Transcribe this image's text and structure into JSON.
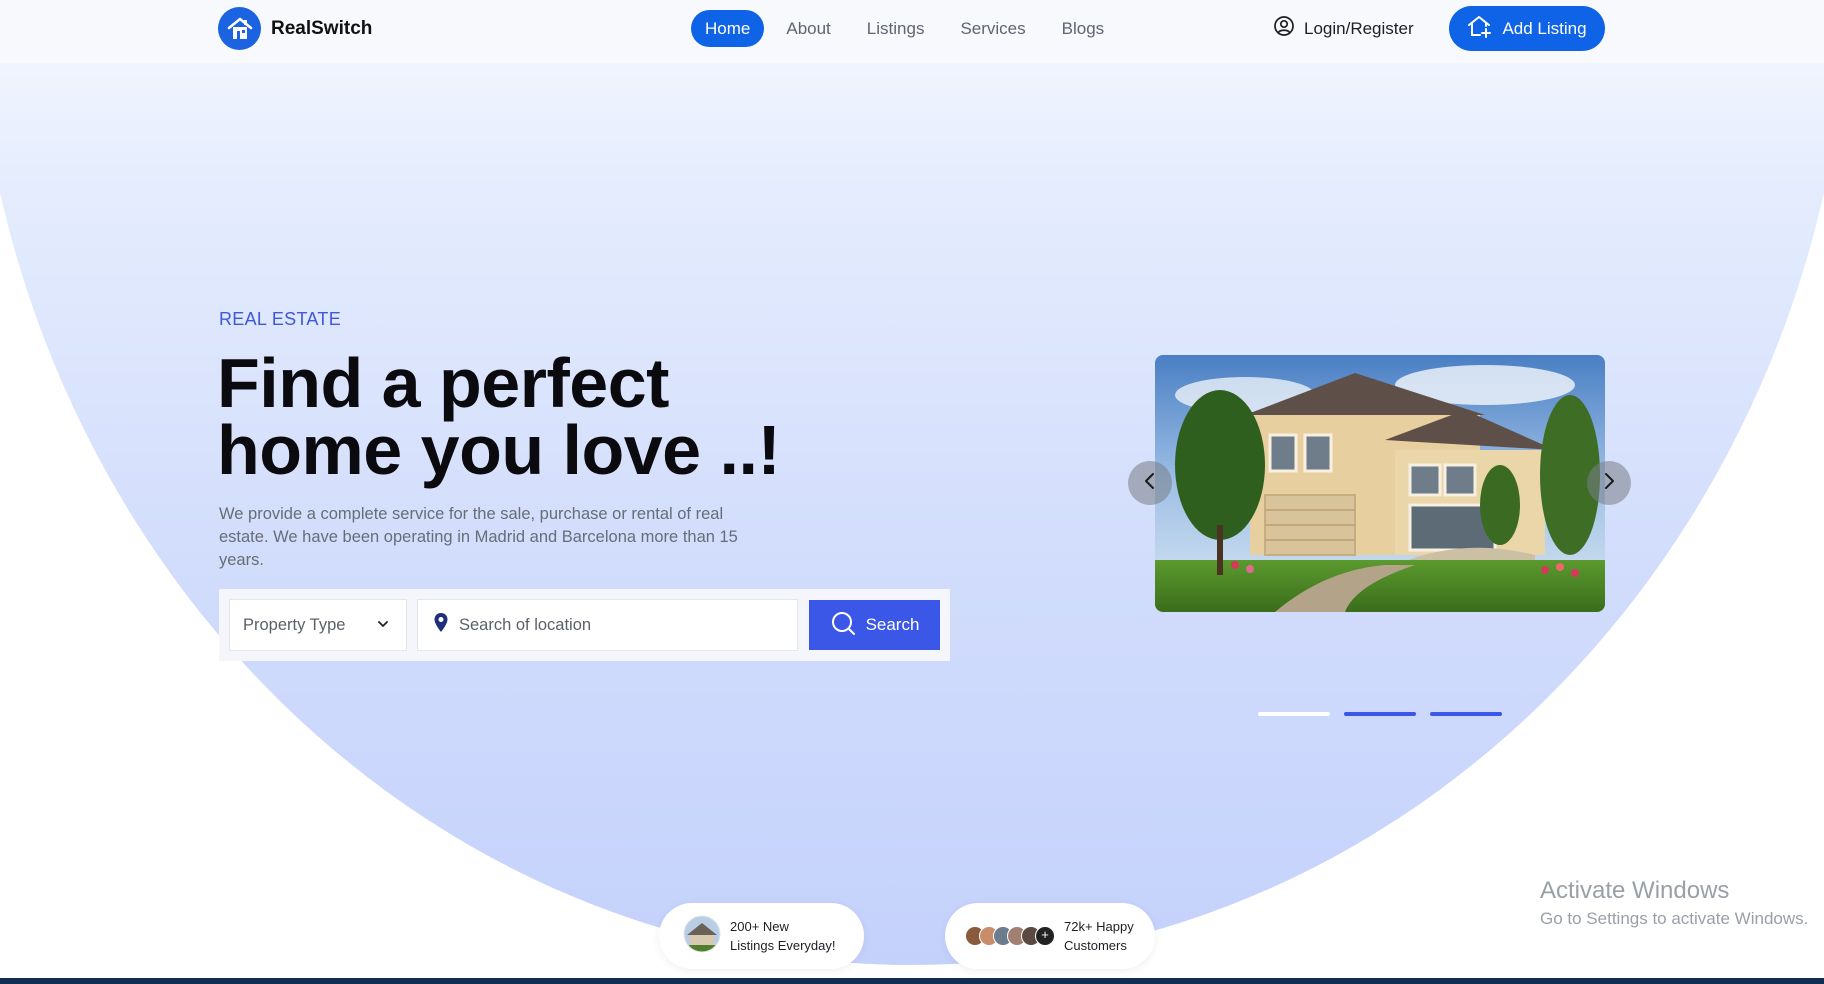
{
  "brand": {
    "name": "RealSwitch",
    "color": "#1b63e0"
  },
  "nav": {
    "links": [
      {
        "label": "Home",
        "active": true
      },
      {
        "label": "About",
        "active": false
      },
      {
        "label": "Listings",
        "active": false
      },
      {
        "label": "Services",
        "active": false
      },
      {
        "label": "Blogs",
        "active": false
      }
    ],
    "login_label": "Login/Register",
    "add_listing_label": "Add Listing"
  },
  "hero": {
    "eyebrow": "REAL ESTATE",
    "headline_line1": "Find a perfect",
    "headline_line2": "home you love ..!",
    "description": "We provide a complete service for the sale, purchase or rental of real estate. We have been operating in Madrid and Barcelona more than 15 years."
  },
  "search": {
    "property_type_label": "Property Type",
    "location_placeholder": "Search of location",
    "button_label": "Search"
  },
  "carousel": {
    "slide_count": 3,
    "current_slide": 1,
    "icons": {
      "prev": "chevron-left-icon",
      "next": "chevron-right-icon"
    }
  },
  "stats": [
    {
      "line1": "200+ New",
      "line2": "Listings Everyday!"
    },
    {
      "line1": "72k+ Happy",
      "line2": "Customers"
    }
  ],
  "watermark": {
    "title": "Activate Windows",
    "subtitle": "Go to Settings to activate Windows."
  },
  "colors": {
    "primary": "#0e63e6",
    "accent": "#3a57e8",
    "eyebrow": "#3f58d8"
  }
}
